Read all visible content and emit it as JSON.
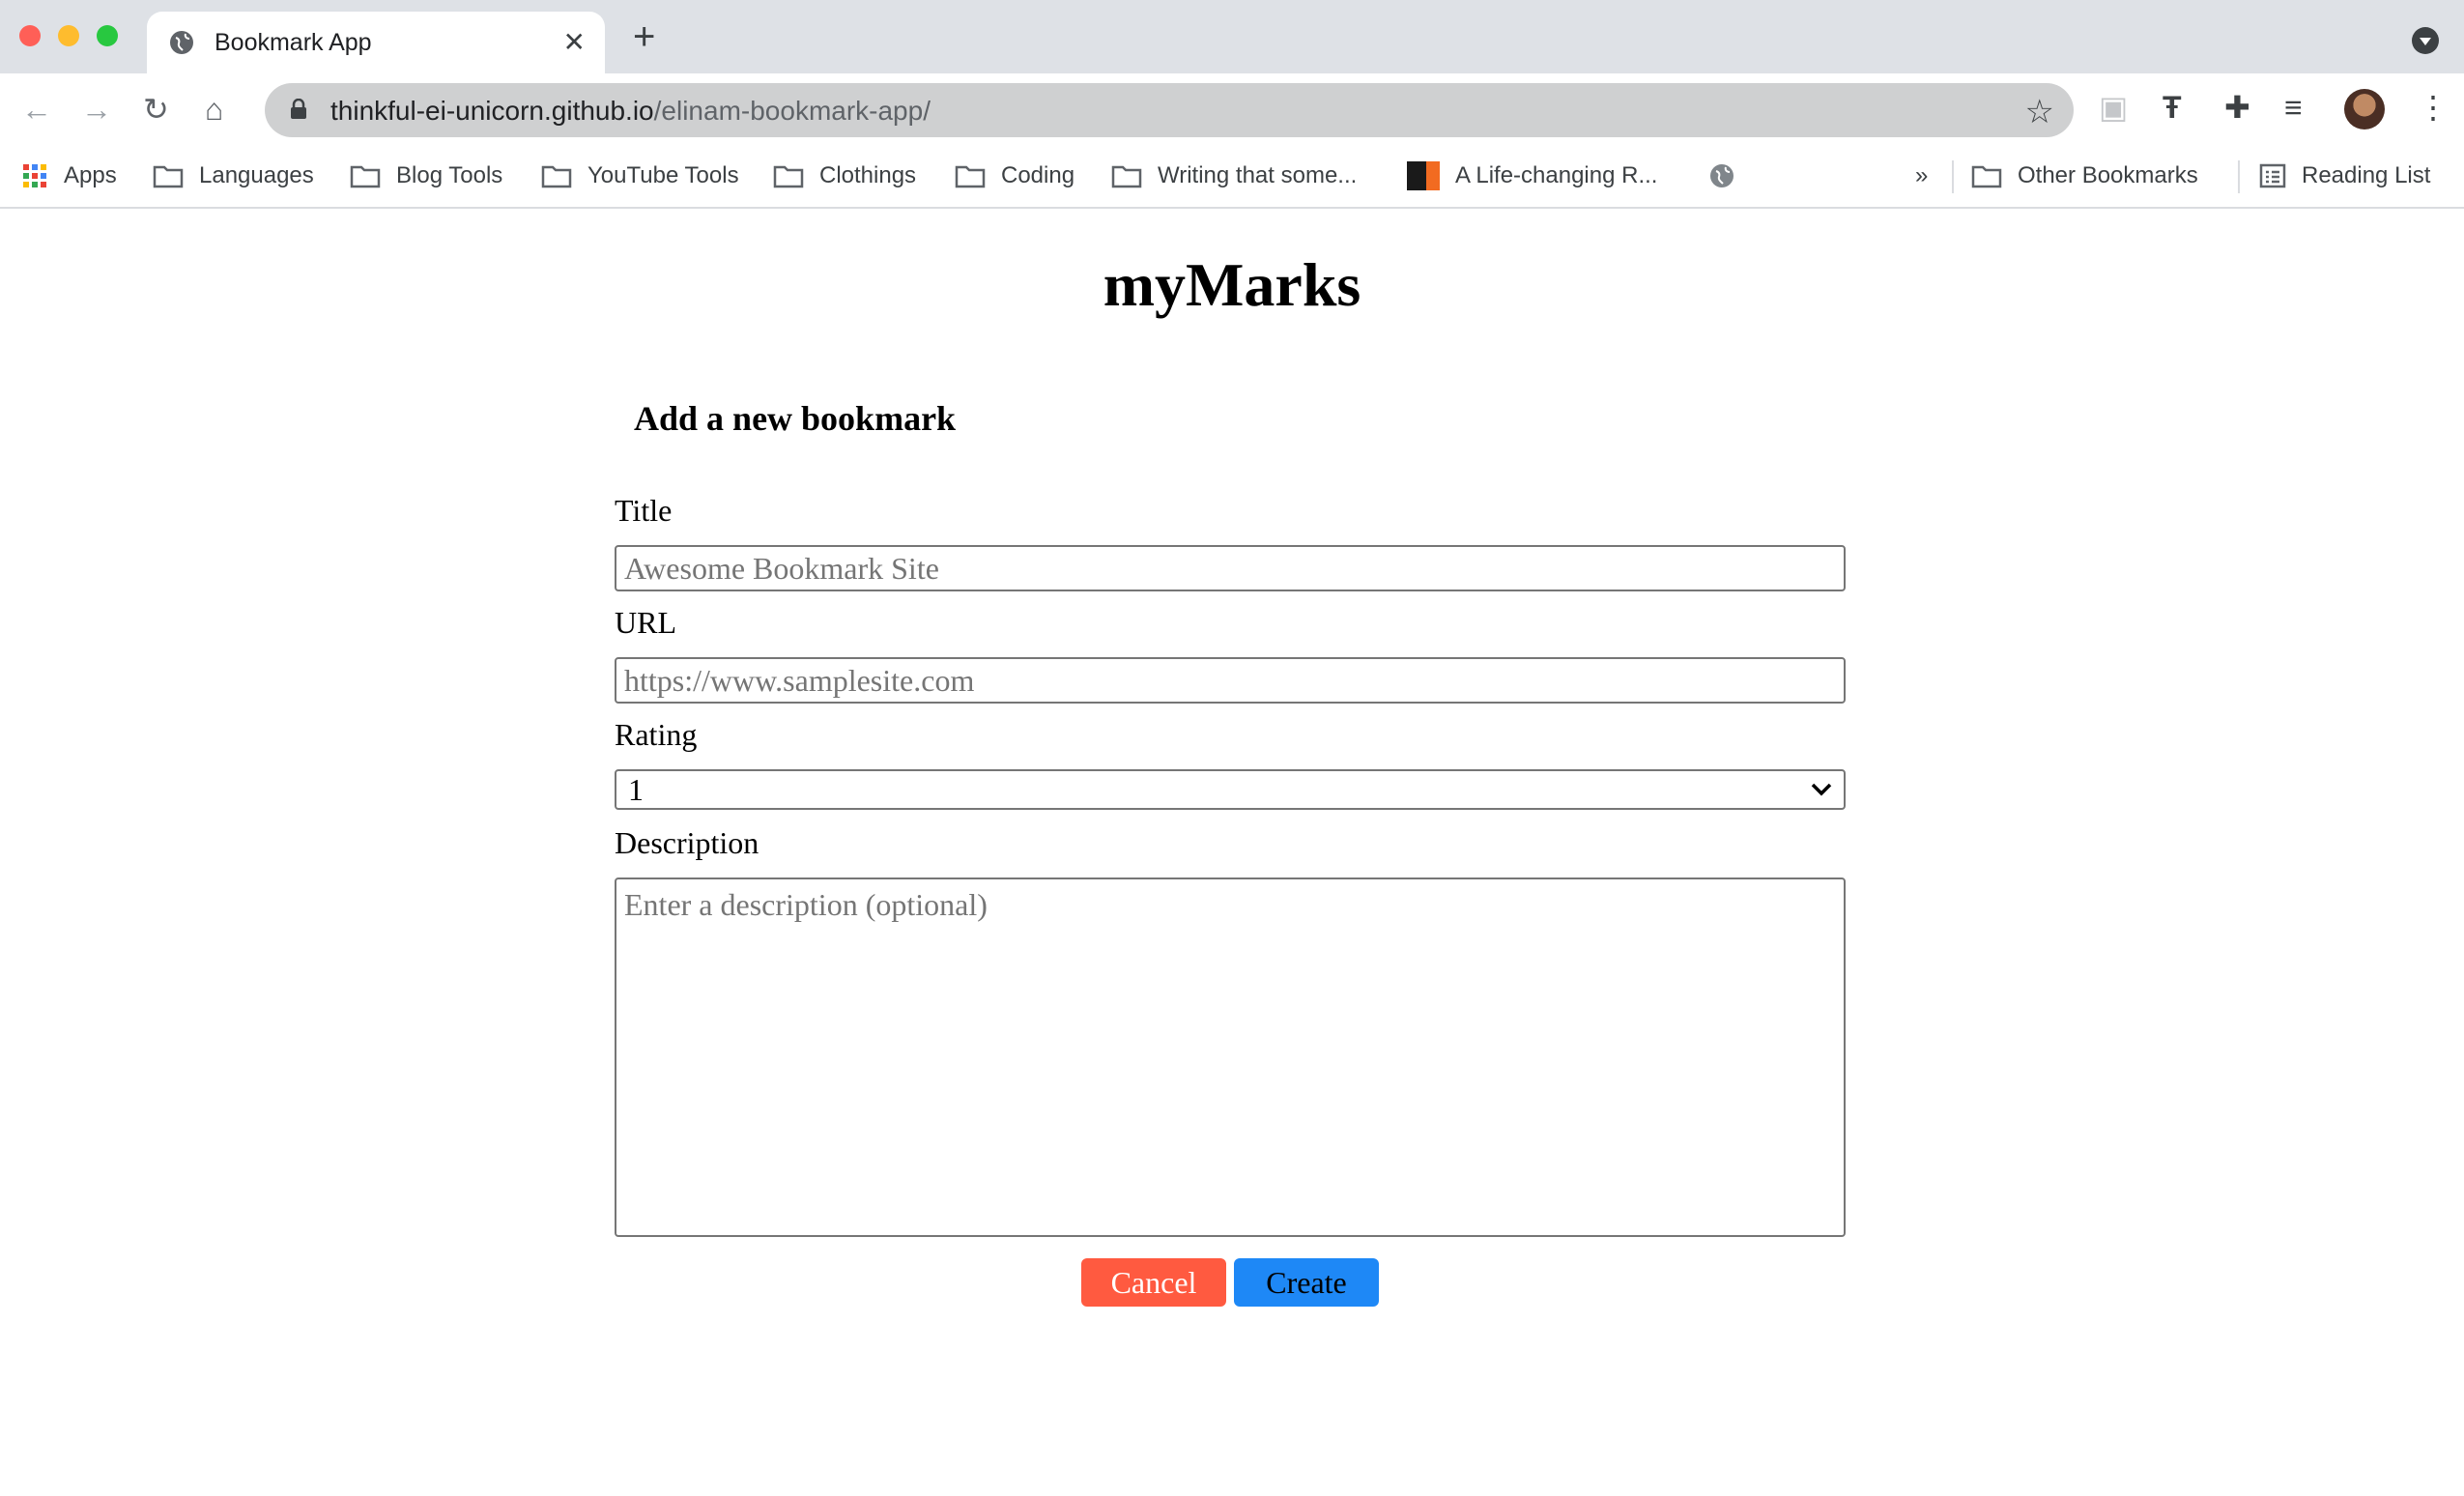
{
  "browser": {
    "tab_title": "Bookmark App",
    "new_tab_label": "+",
    "url_host": "thinkful-ei-unicorn.github.io",
    "url_path": "/elinam-bookmark-app/",
    "bookmarks_bar": [
      "Apps",
      "Languages",
      "Blog Tools",
      "YouTube Tools",
      "Clothings",
      "Coding",
      "Writing that some...",
      "A Life-changing R...",
      "»",
      "Other Bookmarks",
      "Reading List"
    ],
    "icons": [
      "back-icon",
      "forward-icon",
      "reload-icon",
      "home-icon",
      "lock-icon",
      "star-icon",
      "extension-icon",
      "puzzle-icon",
      "media-icon",
      "kebab-icon",
      "globe-icon",
      "folder-icon",
      "apps-grid-icon",
      "reading-list-icon"
    ]
  },
  "app": {
    "title": "myMarks",
    "form_heading": "Add a new bookmark",
    "fields": {
      "title_label": "Title",
      "title_placeholder": "Awesome Bookmark Site",
      "url_label": "URL",
      "url_placeholder": "https://www.samplesite.com",
      "rating_label": "Rating",
      "rating_value": "1",
      "description_label": "Description",
      "description_placeholder": "Enter a description (optional)"
    },
    "buttons": {
      "cancel": "Cancel",
      "create": "Create"
    },
    "colors": {
      "cancel_bg": "#ff5a40",
      "create_bg": "#1e88f6"
    }
  }
}
